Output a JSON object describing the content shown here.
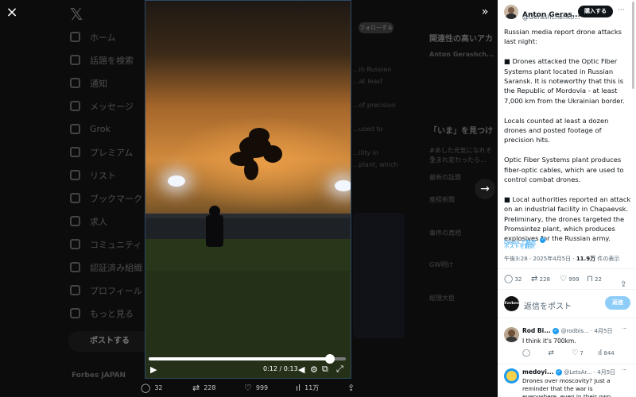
{
  "viewer": {
    "close_label": "×",
    "collapse_label": "»",
    "next_label": "→"
  },
  "background": {
    "nav": [
      "ホーム",
      "話題を検索",
      "通知",
      "メッセージ",
      "Grok",
      "プレミアム",
      "リスト",
      "ブックマーク",
      "求人",
      "コミュニティ",
      "認証済み組織",
      "プロフィール",
      "もっと見る"
    ],
    "post_button": "ポストする",
    "account": "Forbes JAPAN",
    "follow_button": "フォローする",
    "middle_text": [
      "...in Russian",
      "...at least",
      "",
      "...of precision",
      "",
      "...used to",
      "",
      "...ility in",
      "...plant, which"
    ],
    "right_title_1": "関連性の高いアカ",
    "right_account_1": "Anton Gerashch...",
    "right_title_2": "「いま」を見つけ",
    "right_trends": [
      "#あした元気になれそう",
      "生まれ変わったら...",
      "最新の話題",
      "産経新聞",
      "事件の真相",
      "GW明け",
      "総理大臣"
    ]
  },
  "video": {
    "time": "0:12 / 0:13",
    "progress": 0.92
  },
  "video_stats": {
    "replies": "32",
    "retweets": "228",
    "likes": "999",
    "views": "11万"
  },
  "panel": {
    "author_name": "Anton Geras...",
    "author_handle": "@Gerashchenko...",
    "subscribe_label": "購入する",
    "more_label": "···",
    "paragraphs": [
      "Russian media report drone attacks last night:",
      "■ Drones attacked the Optic Fiber Systems plant located in Russian Saransk. It is noteworthy that this is the Republic of Mordovia - at least 7,000 km from the Ukrainian border.",
      "Locals counted at least a dozen drones and posted footage of precision hits.",
      "Optic Fiber Systems plant produces fiber-optic cables, which are used to control combat drones.",
      "■ Local authorities reported an attack on an industrial facility in Chapaevsk. Preliminary, the drones targeted the Promsintez plant, which produces explosives for the Russian army."
    ],
    "deepl_label": "DeepLで翻訳",
    "translate_label": "ポストを翻訳",
    "timestamp": "午後3:28 · 2025年4月5日 ·",
    "view_count": "11.9万",
    "view_suffix": "件の表示",
    "stats": {
      "replies": "32",
      "retweets": "228",
      "likes": "999",
      "bookmarks": "22"
    },
    "reply_avatar_label": "Forbes",
    "reply_placeholder": "返信をポスト",
    "reply_button": "返信",
    "replies": [
      {
        "name": "Rod Bi...",
        "handle": "@rodbis...",
        "date": "· 4月5日",
        "text": "I think it's 700km.",
        "retweets": "",
        "likes": "7",
        "views": "844"
      },
      {
        "name": "medoyi...",
        "handle": "@LetsAr...",
        "date": "· 4月5日",
        "text": "Drones over moscovity? Just a reminder that the war is everywhere, even in their own backyard. Every",
        "retweets": "",
        "likes": "",
        "views": ""
      }
    ]
  },
  "colors": {
    "accent": "#1d9bf0",
    "panel_bg": "#ffffff",
    "backdrop": "#000000",
    "video_sky": "#c47a2c"
  }
}
